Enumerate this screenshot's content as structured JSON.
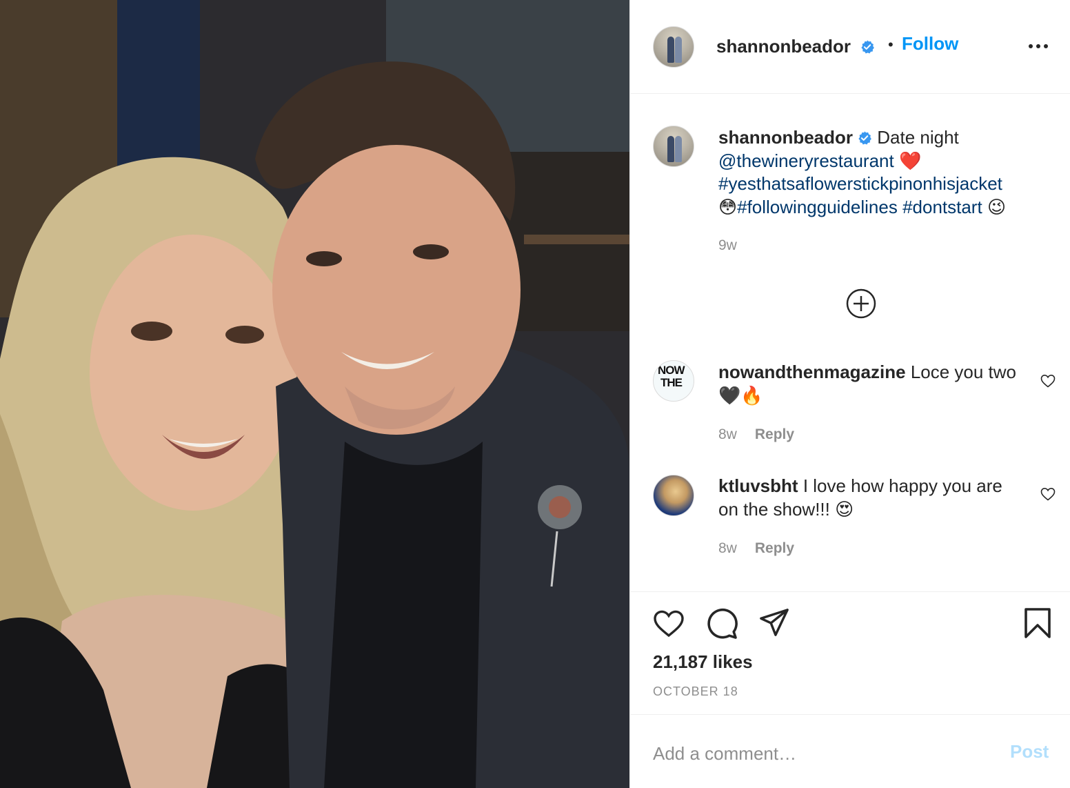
{
  "post": {
    "author": "shannonbeador",
    "follow_label": "Follow",
    "separator": "•",
    "caption": {
      "author": "shannonbeador",
      "text": "Date night",
      "mention": "@thewineryrestaurant",
      "heart_emoji": "❤️",
      "hashtag1": "#yesthatsaflowerstickpinonhisjacket",
      "flushed_emoji": "😳",
      "hashtag2": "#followingguidelines",
      "hashtag3": "#dontstart",
      "wink_emoji": "😉",
      "age": "9w"
    },
    "comments": [
      {
        "user": "nowandthenmagazine",
        "text": "Loce you two",
        "emoji": "🖤🔥",
        "age": "8w",
        "reply_label": "Reply",
        "avatar_text_1": "NOW",
        "avatar_text_2": "THE"
      },
      {
        "user": "ktluvsbht",
        "text": "I love how happy you are on the show!!!",
        "emoji": "😍",
        "age": "8w",
        "reply_label": "Reply"
      }
    ],
    "likes": "21,187 likes",
    "date": "OCTOBER 18",
    "comment_placeholder": "Add a comment…",
    "post_label": "Post"
  },
  "colors": {
    "accent": "#0095f6",
    "link": "#00376b",
    "muted": "#8e8e8e",
    "post_disabled": "#b2dffc",
    "verified": "#3897f0"
  },
  "icons": {
    "more": "more-horizontal-icon",
    "add": "plus-circle-icon",
    "like": "heart-icon",
    "comment": "comment-bubble-icon",
    "share": "paper-plane-icon",
    "save": "bookmark-icon",
    "verified": "verified-badge-icon"
  }
}
